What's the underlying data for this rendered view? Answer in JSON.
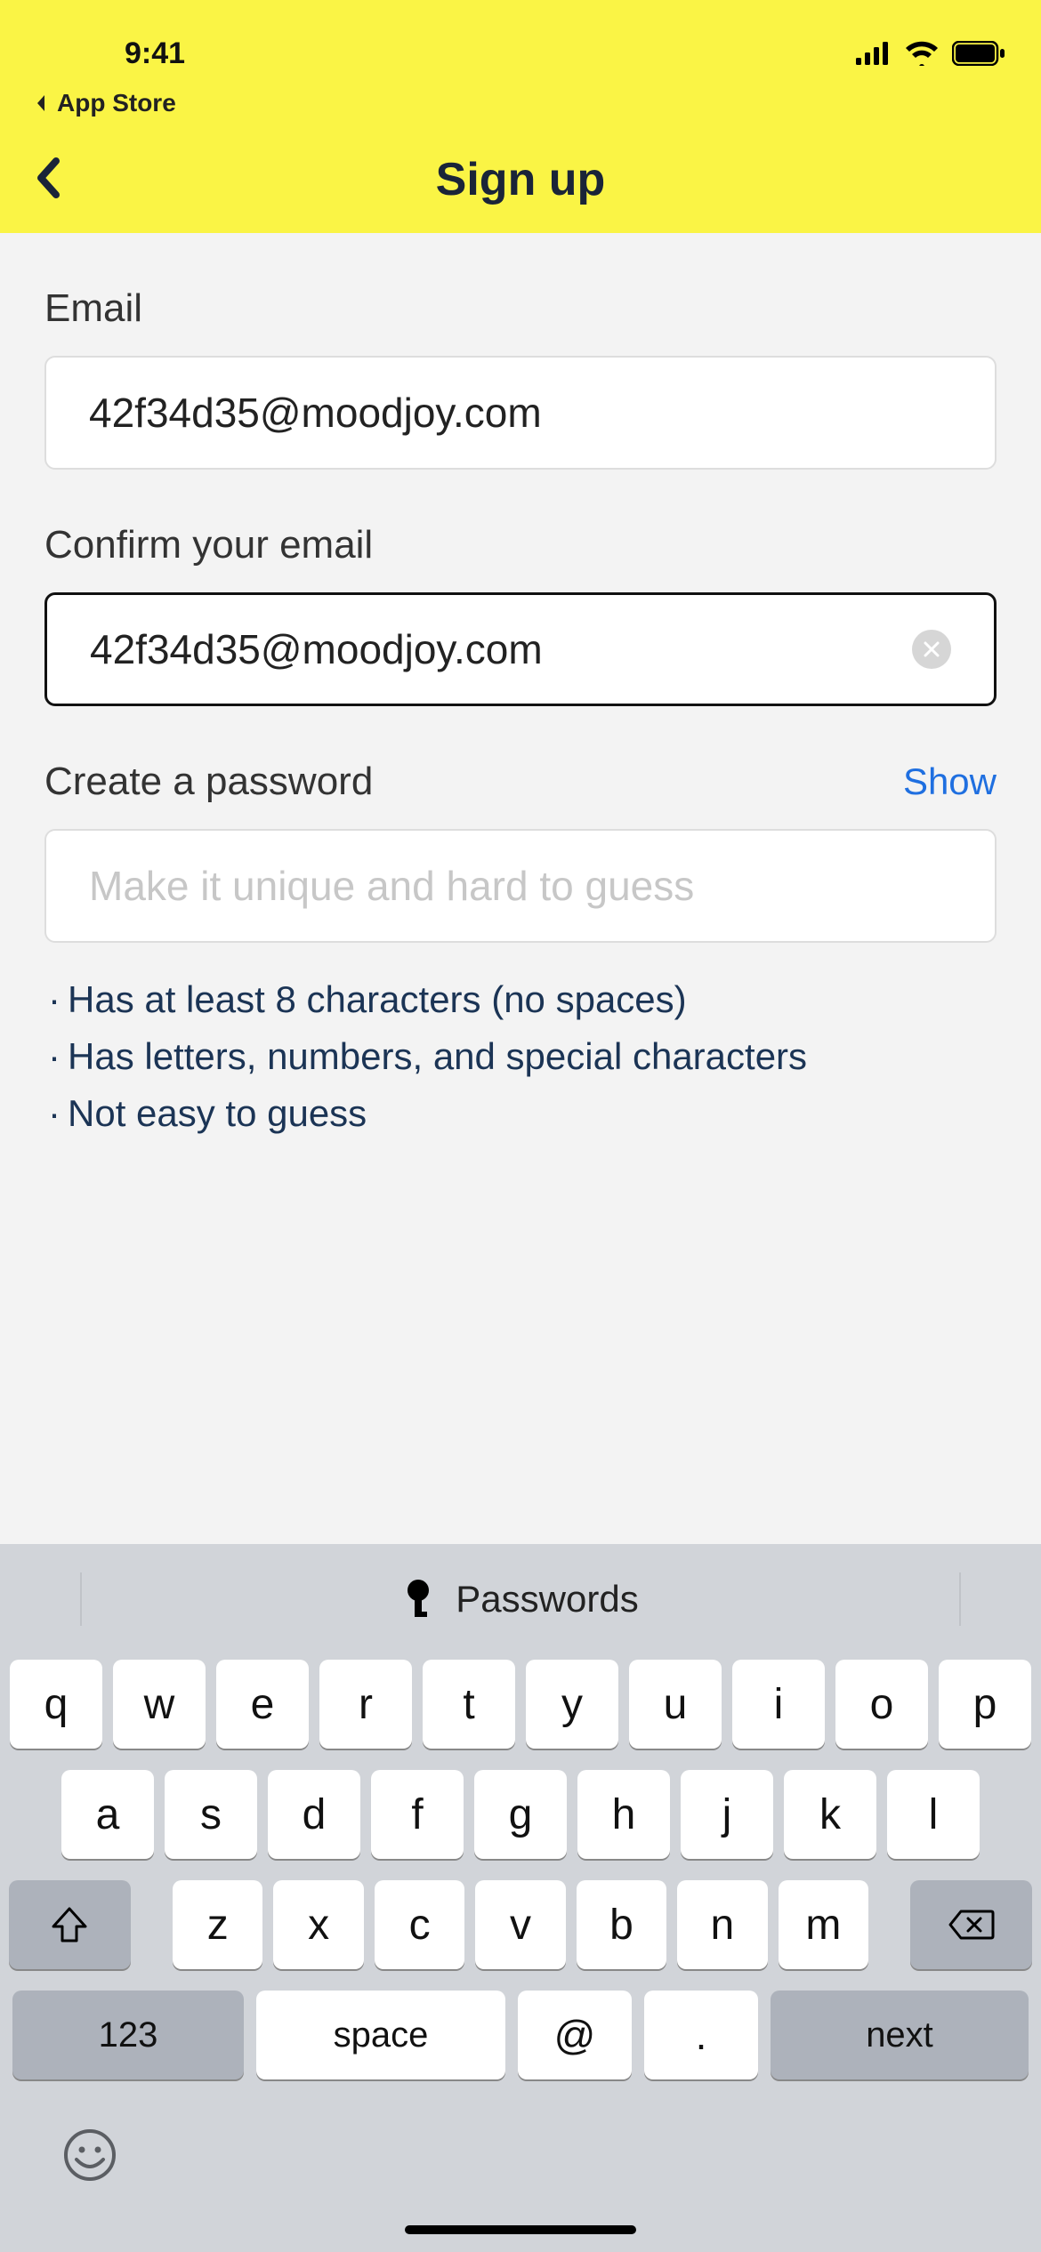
{
  "status": {
    "time": "9:41",
    "back_app": "App Store"
  },
  "nav": {
    "title": "Sign up"
  },
  "form": {
    "email_label": "Email",
    "email_value": "42f34d35@moodjoy.com",
    "confirm_label": "Confirm your email",
    "confirm_value": "42f34d35@moodjoy.com",
    "password_label": "Create a password",
    "password_show": "Show",
    "password_placeholder": "Make it unique and hard to guess",
    "rules": [
      "Has at least 8 characters (no spaces)",
      "Has letters, numbers, and special characters",
      "Not easy to guess"
    ]
  },
  "keyboard": {
    "suggest": "Passwords",
    "row1": [
      "q",
      "w",
      "e",
      "r",
      "t",
      "y",
      "u",
      "i",
      "o",
      "p"
    ],
    "row2": [
      "a",
      "s",
      "d",
      "f",
      "g",
      "h",
      "j",
      "k",
      "l"
    ],
    "row3": [
      "z",
      "x",
      "c",
      "v",
      "b",
      "n",
      "m"
    ],
    "k123": "123",
    "space": "space",
    "at": "@",
    "dot": ".",
    "next": "next"
  }
}
